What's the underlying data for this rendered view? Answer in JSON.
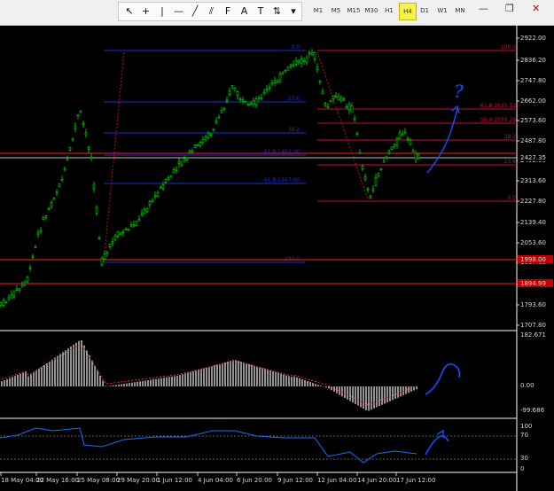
{
  "toolbar": {
    "tools": [
      {
        "name": "cursor-tool",
        "glyph": "↖"
      },
      {
        "name": "crosshair-tool",
        "glyph": "+"
      },
      {
        "name": "vertical-line-tool",
        "glyph": "|"
      },
      {
        "name": "horizontal-line-tool",
        "glyph": "—"
      },
      {
        "name": "trendline-tool",
        "glyph": "╱"
      },
      {
        "name": "channel-tool",
        "glyph": "⫽"
      },
      {
        "name": "fibonacci-tool",
        "glyph": "F"
      },
      {
        "name": "text-tool",
        "glyph": "A"
      },
      {
        "name": "label-tool",
        "glyph": "T"
      },
      {
        "name": "arrows-tool",
        "glyph": "⇅"
      },
      {
        "name": "dropdown-tool",
        "glyph": "▾"
      }
    ],
    "timeframes": [
      "M1",
      "M5",
      "M15",
      "M30",
      "H1",
      "H4",
      "D1",
      "W1",
      "MN"
    ],
    "active_timeframe": "H4",
    "minimize_glyph": "—",
    "restore_glyph": "❐",
    "close_glyph": "✕"
  },
  "price_scale": [
    "2922.00",
    "2836.20",
    "2747.80",
    "2662.00",
    "2573.60",
    "2487.80",
    "2402.00",
    "2313.60",
    "2227.80",
    "2139.40",
    "2053.60",
    "1967.80",
    "1879.40",
    "1793.60",
    "1707.80"
  ],
  "price_tags": [
    {
      "text": "1998.00",
      "color": "#c00000"
    },
    {
      "text": "1894.99",
      "color": "#c00000"
    },
    {
      "text": "2427.35",
      "color": "#d8d8d8"
    }
  ],
  "fib_labels_blue": [
    "0.0",
    "23.6",
    "38.2",
    "61.8  2463.36",
    "61.8  2367.00",
    "100.0"
  ],
  "fib_labels_red": [
    "100.0",
    "61.8  2635.12",
    "50.0  2559.29",
    "38.2",
    "23.6",
    "0.0"
  ],
  "macd_scale": [
    "182.671",
    "0.00",
    "-99.686"
  ],
  "rsi_scale": [
    "100",
    "70",
    "30",
    "0"
  ],
  "time_labels": [
    "18 May 04:00",
    "22 May 16:00",
    "25 May 08:00",
    "29 May 20:00",
    "1 Jun 12:00",
    "4 Jun 04:00",
    "6 Jun 20:00",
    "9 Jun 12:00",
    "12 Jun 04:00",
    "14 Jun 20:00",
    "17 Jun 12:00"
  ],
  "annotations": {
    "question_mark": "?"
  },
  "colors": {
    "candle": "#00e000",
    "fib_blue": "#1f2fd0",
    "fib_red": "#c4103c",
    "level_red": "#ff2020",
    "macd_bar": "#f0f0f0",
    "macd_signal": "#ff3030",
    "rsi_line": "#1e6cff",
    "annotation": "#1050ff"
  },
  "chart_data": {
    "type": "candlestick",
    "timeframe": "H4",
    "y_axis_range": [
      1707.8,
      2922.0
    ],
    "close_path": [
      [
        "18 May 04:00",
        1760
      ],
      [
        "20 May 04:00",
        1850
      ],
      [
        "22 May 16:00",
        2330
      ],
      [
        "24 May 00:00",
        2600
      ],
      [
        "25 May 08:00",
        1998
      ],
      [
        "27 May 00:00",
        2200
      ],
      [
        "29 May 20:00",
        2280
      ],
      [
        "1 Jun 12:00",
        2390
      ],
      [
        "3 Jun 00:00",
        2560
      ],
      [
        "4 Jun 04:00",
        2720
      ],
      [
        "6 Jun 20:00",
        2700
      ],
      [
        "9 Jun 12:00",
        2880
      ],
      [
        "10 Jun 12:00",
        2820
      ],
      [
        "12 Jun 04:00",
        2650
      ],
      [
        "13 Jun 12:00",
        2460
      ],
      [
        "14 Jun 20:00",
        2270
      ],
      [
        "16 Jun 00:00",
        2450
      ],
      [
        "17 Jun 12:00",
        2430
      ]
    ],
    "horizontal_levels": [
      1998.0,
      1894.99,
      2427.35
    ],
    "fibonacci_blue": {
      "high": 2880,
      "low": 1998,
      "levels": [
        0,
        23.6,
        38.2,
        61.8,
        100
      ]
    },
    "fibonacci_red": {
      "high": 2880,
      "low": 2260,
      "levels": [
        0,
        23.6,
        38.2,
        50,
        61.8,
        100
      ]
    },
    "macd": {
      "range": [
        -99.686,
        182.671
      ]
    },
    "rsi": {
      "levels": [
        30,
        70
      ],
      "range": [
        0,
        100
      ]
    }
  }
}
